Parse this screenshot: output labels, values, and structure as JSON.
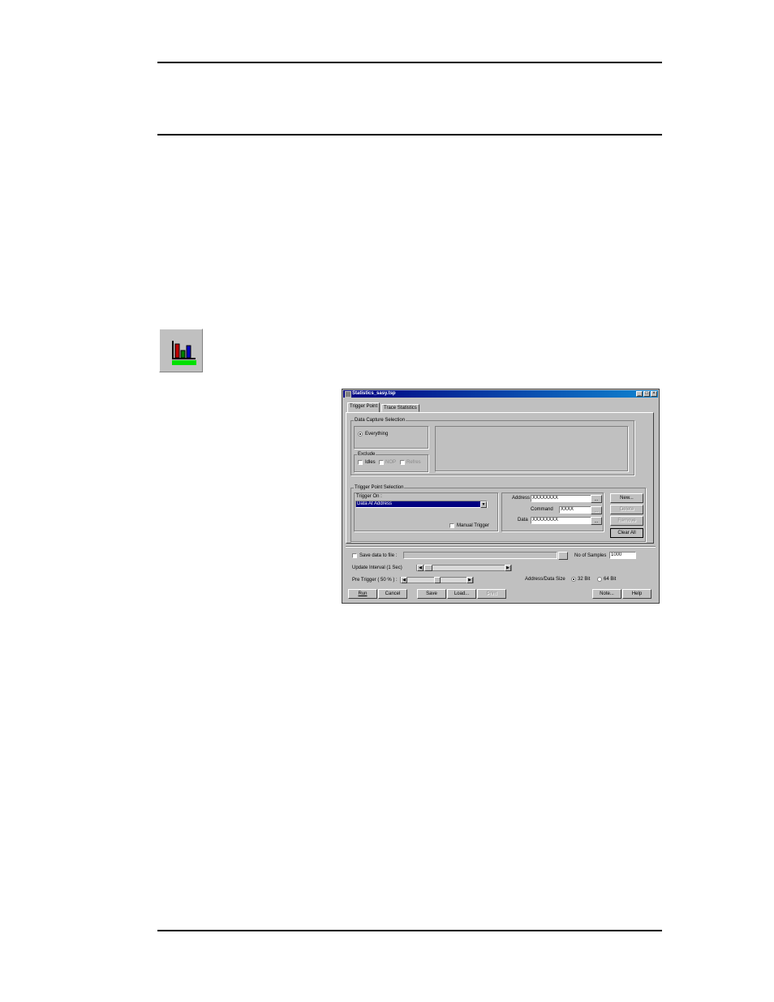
{
  "window": {
    "title": "Statistics_sasy.tsp"
  },
  "tabs": [
    "Trigger Point",
    "Trace Statistics"
  ],
  "data_capture": {
    "caption": "Data Capture Selection",
    "everything_label": "Everything",
    "exclude_caption": "Exclude",
    "exclude_items": [
      "Idles",
      "NOP",
      "Refres"
    ]
  },
  "trigger": {
    "caption": "Trigger Point Selection",
    "trigger_on_label": "Trigger On :",
    "trigger_on_value": "Data At Address",
    "manual_trigger_label": "Manual Trigger",
    "address_label": "Address",
    "address_value": "XXXXXXXX",
    "command_label": "Command",
    "command_value": "XXXX",
    "data_label": "Data",
    "data_value": "XXXXXXXX",
    "ellipsis": "...",
    "buttons": [
      "New...",
      "Delete",
      "Remove",
      "Clear All"
    ]
  },
  "options": {
    "save_to_file_label": "Save data to file :",
    "samples_label": "No of Samples",
    "samples_value": "1000",
    "update_interval_label": "Update Interval (1 Sec)",
    "pre_trigger_label": "Pre Trigger ( 50 % ) :",
    "pre_trigger_percent": 50,
    "address_data_size_label": "Address/Data Size",
    "size_32_label": "32 Bit",
    "size_64_label": "64 Bit"
  },
  "bottom_buttons": [
    "Run",
    "Cancel",
    "Save",
    "Load...",
    "Print",
    "Note...",
    "Help"
  ],
  "colors": {
    "titlebar": "#000080",
    "selection": "#000080",
    "face": "#c0c0c0"
  },
  "icons": {
    "toolbar": "bar-chart-icon"
  }
}
